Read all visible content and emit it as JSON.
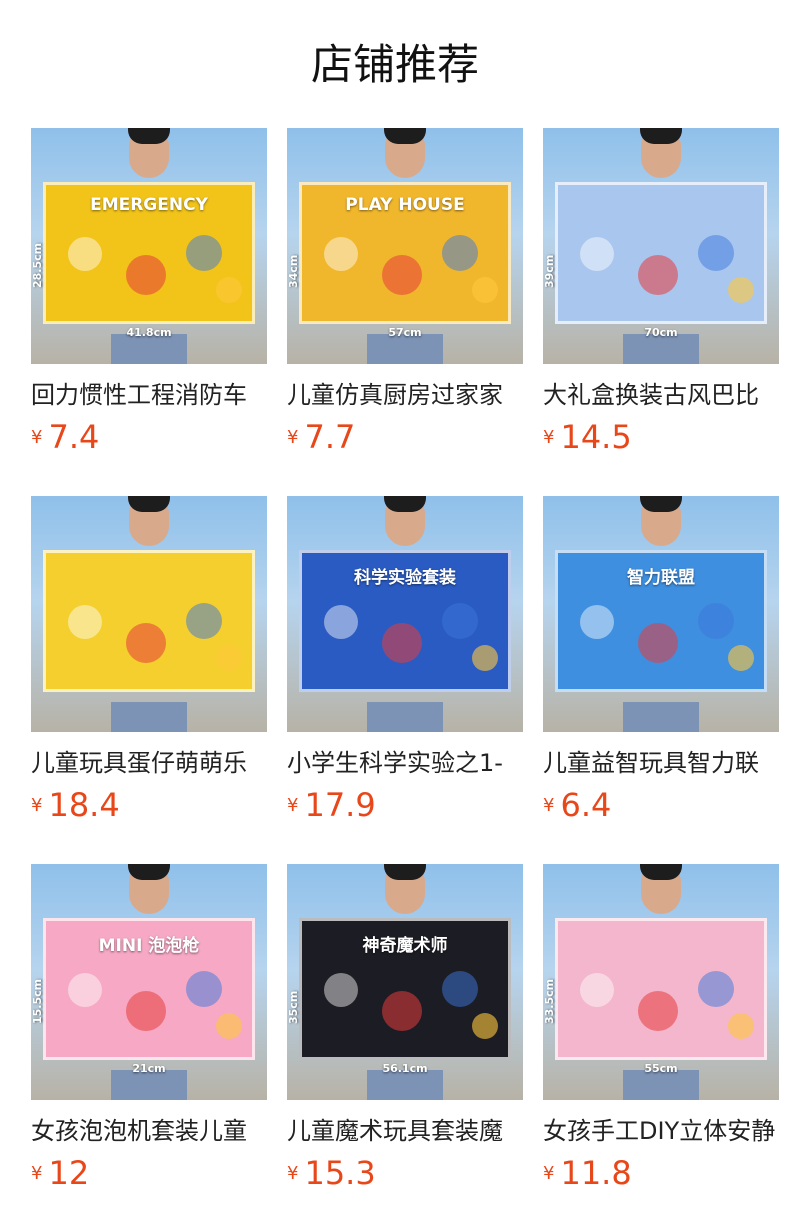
{
  "header": {
    "title": "店铺推荐"
  },
  "currency_symbol": "¥",
  "colors": {
    "price": "#e8471a",
    "title": "#111111"
  },
  "products": [
    {
      "name": "回力惯性工程消防车",
      "price": "7.4",
      "box_text": "EMERGENCY",
      "dim_h": "41.8cm",
      "dim_v": "28.5cm",
      "box_color": "#f2c41a"
    },
    {
      "name": "儿童仿真厨房过家家",
      "price": "7.7",
      "box_text": "PLAY HOUSE",
      "dim_h": "57cm",
      "dim_v": "34cm",
      "box_color": "#f1b72c"
    },
    {
      "name": "大礼盒换装古风巴比",
      "price": "14.5",
      "box_text": "",
      "dim_h": "70cm",
      "dim_v": "39cm",
      "box_color": "#a9c6ee"
    },
    {
      "name": "儿童玩具蛋仔萌萌乐",
      "price": "18.4",
      "box_text": "",
      "dim_h": "",
      "dim_v": "",
      "box_color": "#f4cf2e"
    },
    {
      "name": "小学生科学实验之1-",
      "price": "17.9",
      "box_text": "科学实验套装",
      "dim_h": "",
      "dim_v": "",
      "box_color": "#2a5bc2"
    },
    {
      "name": "儿童益智玩具智力联",
      "price": "6.4",
      "box_text": "智力联盟",
      "dim_h": "",
      "dim_v": "",
      "box_color": "#3f8fe0"
    },
    {
      "name": "女孩泡泡机套装儿童",
      "price": "12",
      "box_text": "MINI 泡泡枪",
      "dim_h": "21cm",
      "dim_v": "15.5cm",
      "box_color": "#f6a8c4"
    },
    {
      "name": "儿童魔术玩具套装魔",
      "price": "15.3",
      "box_text": "神奇魔术师",
      "dim_h": "56.1cm",
      "dim_v": "35cm",
      "box_color": "#1c1c24"
    },
    {
      "name": "女孩手工DIY立体安静",
      "price": "11.8",
      "box_text": "",
      "dim_h": "55cm",
      "dim_v": "33.5cm",
      "box_color": "#f3b6cc"
    }
  ]
}
